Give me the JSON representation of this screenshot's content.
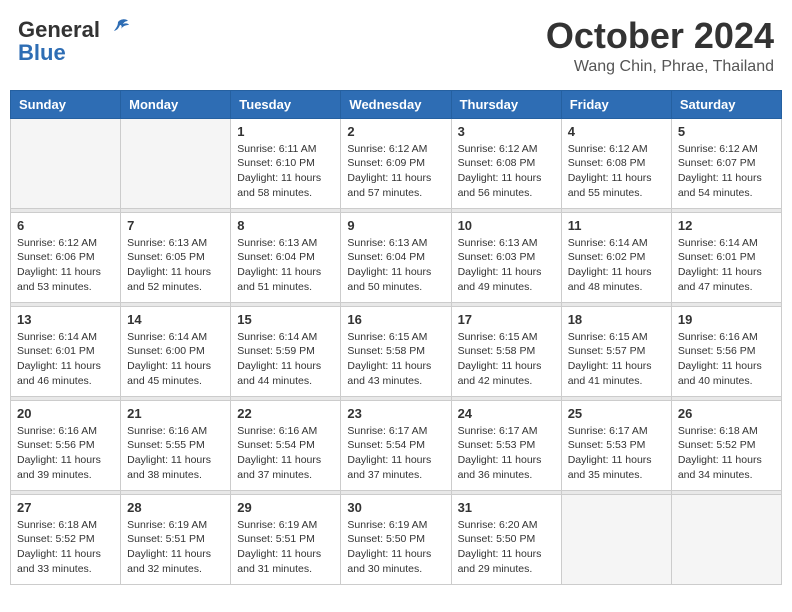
{
  "header": {
    "logo_general": "General",
    "logo_blue": "Blue",
    "month": "October 2024",
    "location": "Wang Chin, Phrae, Thailand"
  },
  "days_of_week": [
    "Sunday",
    "Monday",
    "Tuesday",
    "Wednesday",
    "Thursday",
    "Friday",
    "Saturday"
  ],
  "weeks": [
    [
      {
        "day": "",
        "info": ""
      },
      {
        "day": "",
        "info": ""
      },
      {
        "day": "1",
        "info": "Sunrise: 6:11 AM\nSunset: 6:10 PM\nDaylight: 11 hours and 58 minutes."
      },
      {
        "day": "2",
        "info": "Sunrise: 6:12 AM\nSunset: 6:09 PM\nDaylight: 11 hours and 57 minutes."
      },
      {
        "day": "3",
        "info": "Sunrise: 6:12 AM\nSunset: 6:08 PM\nDaylight: 11 hours and 56 minutes."
      },
      {
        "day": "4",
        "info": "Sunrise: 6:12 AM\nSunset: 6:08 PM\nDaylight: 11 hours and 55 minutes."
      },
      {
        "day": "5",
        "info": "Sunrise: 6:12 AM\nSunset: 6:07 PM\nDaylight: 11 hours and 54 minutes."
      }
    ],
    [
      {
        "day": "6",
        "info": "Sunrise: 6:12 AM\nSunset: 6:06 PM\nDaylight: 11 hours and 53 minutes."
      },
      {
        "day": "7",
        "info": "Sunrise: 6:13 AM\nSunset: 6:05 PM\nDaylight: 11 hours and 52 minutes."
      },
      {
        "day": "8",
        "info": "Sunrise: 6:13 AM\nSunset: 6:04 PM\nDaylight: 11 hours and 51 minutes."
      },
      {
        "day": "9",
        "info": "Sunrise: 6:13 AM\nSunset: 6:04 PM\nDaylight: 11 hours and 50 minutes."
      },
      {
        "day": "10",
        "info": "Sunrise: 6:13 AM\nSunset: 6:03 PM\nDaylight: 11 hours and 49 minutes."
      },
      {
        "day": "11",
        "info": "Sunrise: 6:14 AM\nSunset: 6:02 PM\nDaylight: 11 hours and 48 minutes."
      },
      {
        "day": "12",
        "info": "Sunrise: 6:14 AM\nSunset: 6:01 PM\nDaylight: 11 hours and 47 minutes."
      }
    ],
    [
      {
        "day": "13",
        "info": "Sunrise: 6:14 AM\nSunset: 6:01 PM\nDaylight: 11 hours and 46 minutes."
      },
      {
        "day": "14",
        "info": "Sunrise: 6:14 AM\nSunset: 6:00 PM\nDaylight: 11 hours and 45 minutes."
      },
      {
        "day": "15",
        "info": "Sunrise: 6:14 AM\nSunset: 5:59 PM\nDaylight: 11 hours and 44 minutes."
      },
      {
        "day": "16",
        "info": "Sunrise: 6:15 AM\nSunset: 5:58 PM\nDaylight: 11 hours and 43 minutes."
      },
      {
        "day": "17",
        "info": "Sunrise: 6:15 AM\nSunset: 5:58 PM\nDaylight: 11 hours and 42 minutes."
      },
      {
        "day": "18",
        "info": "Sunrise: 6:15 AM\nSunset: 5:57 PM\nDaylight: 11 hours and 41 minutes."
      },
      {
        "day": "19",
        "info": "Sunrise: 6:16 AM\nSunset: 5:56 PM\nDaylight: 11 hours and 40 minutes."
      }
    ],
    [
      {
        "day": "20",
        "info": "Sunrise: 6:16 AM\nSunset: 5:56 PM\nDaylight: 11 hours and 39 minutes."
      },
      {
        "day": "21",
        "info": "Sunrise: 6:16 AM\nSunset: 5:55 PM\nDaylight: 11 hours and 38 minutes."
      },
      {
        "day": "22",
        "info": "Sunrise: 6:16 AM\nSunset: 5:54 PM\nDaylight: 11 hours and 37 minutes."
      },
      {
        "day": "23",
        "info": "Sunrise: 6:17 AM\nSunset: 5:54 PM\nDaylight: 11 hours and 37 minutes."
      },
      {
        "day": "24",
        "info": "Sunrise: 6:17 AM\nSunset: 5:53 PM\nDaylight: 11 hours and 36 minutes."
      },
      {
        "day": "25",
        "info": "Sunrise: 6:17 AM\nSunset: 5:53 PM\nDaylight: 11 hours and 35 minutes."
      },
      {
        "day": "26",
        "info": "Sunrise: 6:18 AM\nSunset: 5:52 PM\nDaylight: 11 hours and 34 minutes."
      }
    ],
    [
      {
        "day": "27",
        "info": "Sunrise: 6:18 AM\nSunset: 5:52 PM\nDaylight: 11 hours and 33 minutes."
      },
      {
        "day": "28",
        "info": "Sunrise: 6:19 AM\nSunset: 5:51 PM\nDaylight: 11 hours and 32 minutes."
      },
      {
        "day": "29",
        "info": "Sunrise: 6:19 AM\nSunset: 5:51 PM\nDaylight: 11 hours and 31 minutes."
      },
      {
        "day": "30",
        "info": "Sunrise: 6:19 AM\nSunset: 5:50 PM\nDaylight: 11 hours and 30 minutes."
      },
      {
        "day": "31",
        "info": "Sunrise: 6:20 AM\nSunset: 5:50 PM\nDaylight: 11 hours and 29 minutes."
      },
      {
        "day": "",
        "info": ""
      },
      {
        "day": "",
        "info": ""
      }
    ]
  ]
}
